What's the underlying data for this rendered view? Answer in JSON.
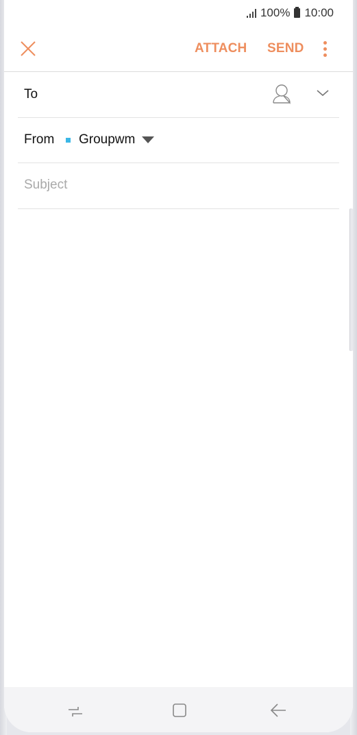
{
  "status_bar": {
    "battery_percent": "100%",
    "time": "10:00"
  },
  "action_bar": {
    "close_icon": "close-icon",
    "attach_label": "ATTACH",
    "send_label": "SEND",
    "more_icon": "more-options-icon"
  },
  "compose": {
    "to_label": "To",
    "contact_icon": "contact-person-icon",
    "expand_icon": "chevron-down-icon",
    "from_label": "From",
    "from_account": "Groupwm",
    "account_color": "#3bb7e6",
    "subject_placeholder": "Subject",
    "subject_value": ""
  },
  "nav_bar": {
    "recent_icon": "recent-apps-icon",
    "home_icon": "home-icon",
    "back_icon": "back-icon"
  },
  "colors": {
    "accent": "#ee8e5e"
  }
}
